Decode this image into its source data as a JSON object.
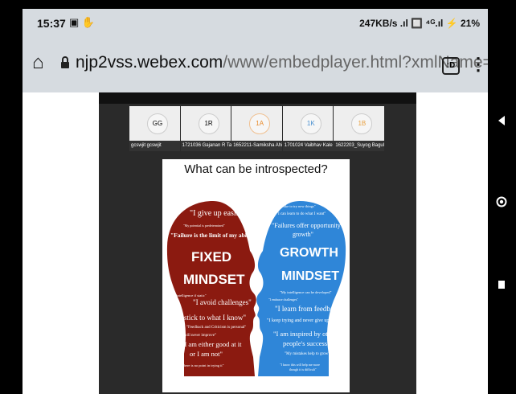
{
  "status_bar": {
    "time": "15:37",
    "left_icons": "▣ ✋",
    "right_text": "247KB/s .ıl 🔲 ⁴ᴳ.ıl ⚡ 21%"
  },
  "browser": {
    "url_domain": "njp2vss.webex.com",
    "url_path": "/www/embedplayer.html?xmlName=recording.xml",
    "tab_count": ":D",
    "menu_label": "⋮"
  },
  "participants": [
    {
      "initials": "GG",
      "name": "gcswjit gcswjit"
    },
    {
      "initials": "1R",
      "name": "1721036 Gajanan R Tak"
    },
    {
      "initials": "1A",
      "name": "1652211-Samiksha Ahir"
    },
    {
      "initials": "1K",
      "name": "1701024 Vaibhav Kale"
    },
    {
      "initials": "1B",
      "name": "1622203_Suyog Bagul"
    }
  ],
  "slide": {
    "title": "What can be introspected?",
    "fixed": {
      "heading1": "FIXED",
      "heading2": "MINDSET",
      "lines": [
        "\"I give up easily\"",
        "\"My potential is predetermined\"",
        "\"Failure is the limit of my abilities\"",
        "\"My intelligence if static\"",
        "\"I avoid challenges\"",
        "\"I stick to what I know\"",
        "\"Feedback and Criticism is personal\"",
        "\"I will never improve\"",
        "\"I am either good at it",
        "or I am not\"",
        "\"There is no point in trying it\""
      ]
    },
    "growth": {
      "heading1": "GROWTH",
      "heading2": "MINDSET",
      "lines": [
        "\"I like to try new things\"",
        "\"I can learn to do what I want\"",
        "\"Failures offer opportunity &",
        "growth\"",
        "\"My intelligence can be developed\"",
        "\"I embrace challenges\"",
        "\"I learn from feedback\"",
        "\"I keep trying and never give up\"",
        "\"I am inspired by others",
        "people's success\"",
        "\"My mistakes help to grow\"",
        "\"I know this will help me more",
        "though it is difficult\""
      ]
    }
  },
  "colors": {
    "fixed_head": "#8b1a10",
    "growth_head": "#2f86d8",
    "browser_bar": "#d6dbe0"
  },
  "icons": {
    "home": "home-icon",
    "lock": "lock-icon",
    "back": "back-triangle-icon",
    "homebtn": "home-circle-icon",
    "recents": "recents-square-icon"
  }
}
